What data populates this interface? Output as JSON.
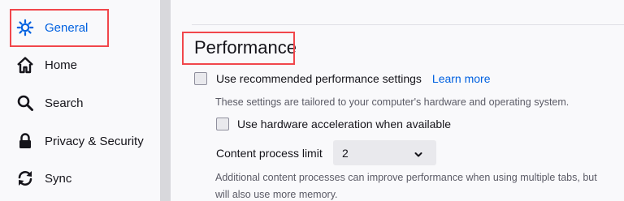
{
  "sidebar": {
    "items": [
      {
        "label": "General",
        "icon": "gear-icon"
      },
      {
        "label": "Home",
        "icon": "home-icon"
      },
      {
        "label": "Search",
        "icon": "search-icon"
      },
      {
        "label": "Privacy & Security",
        "icon": "lock-icon"
      },
      {
        "label": "Sync",
        "icon": "sync-icon"
      }
    ]
  },
  "main": {
    "section_title": "Performance",
    "recommended_label": "Use recommended performance settings",
    "learn_more": "Learn more",
    "recommended_desc": "These settings are tailored to your computer's hardware and operating system.",
    "hw_accel_label": "Use hardware acceleration when available",
    "content_process_label": "Content process limit",
    "content_process_value": "2",
    "content_process_desc_1": "Additional content processes can improve performance when using multiple tabs, but",
    "content_process_desc_2": "will also use more memory."
  },
  "colors": {
    "accent": "#0061e0",
    "annotation": "#f1464b"
  }
}
